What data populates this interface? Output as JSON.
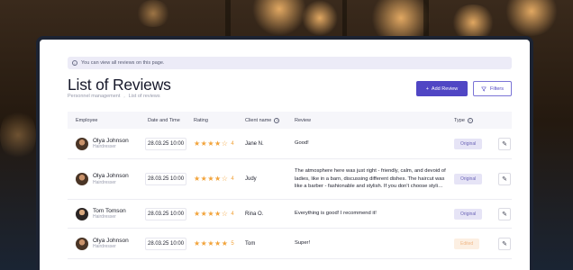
{
  "info": {
    "text": "You can view all reviews on this page."
  },
  "page": {
    "title": "List of Reviews"
  },
  "breadcrumb": [
    "Personnel management",
    "List of reviews"
  ],
  "actions": {
    "add_label": "Add Review",
    "filters_label": "Filters"
  },
  "table": {
    "headers": {
      "employee": "Employee",
      "date": "Date and Time",
      "rating": "Rating",
      "client": "Client name",
      "review": "Review",
      "type": "Type"
    },
    "rows": [
      {
        "name": "Olya Johnson",
        "role": "Hairdresser",
        "date": "28.03.25 10:00",
        "rating": 4,
        "rating_label": "4",
        "client": "Jane N.",
        "review": "Good!",
        "type": "Original"
      },
      {
        "name": "Olya Johnson",
        "role": "Hairdresser",
        "date": "28.03.25 10:00",
        "rating": 4,
        "rating_label": "4",
        "client": "Judy",
        "review": "The atmosphere here was just right - friendly, calm, and devoid of ladies, like in a barn, discussing different dishes. The haircut was like a barber - fashionable and stylish. If you don't choose styli…",
        "type": "Original"
      },
      {
        "name": "Tom Tomson",
        "role": "Hairdresser",
        "date": "28.03.25 10:00",
        "rating": 4,
        "rating_label": "4",
        "client": "Rina O.",
        "review": "Everything is good! I recommend it!",
        "type": "Original"
      },
      {
        "name": "Olya Johnson",
        "role": "Hairdresser",
        "date": "28.03.25 10:00",
        "rating": 5,
        "rating_label": "5",
        "client": "Tom",
        "review": "Super!",
        "type": "Edited"
      }
    ]
  },
  "colors": {
    "accent": "#5046c4",
    "star": "#f2a33a",
    "badge_original": "#e6e4f6",
    "badge_edited": "#fcefe2"
  },
  "icons": {
    "info": "info-icon",
    "add": "plus-icon",
    "filters": "filter-icon",
    "edit": "pencil-icon",
    "star": "star-icon"
  }
}
